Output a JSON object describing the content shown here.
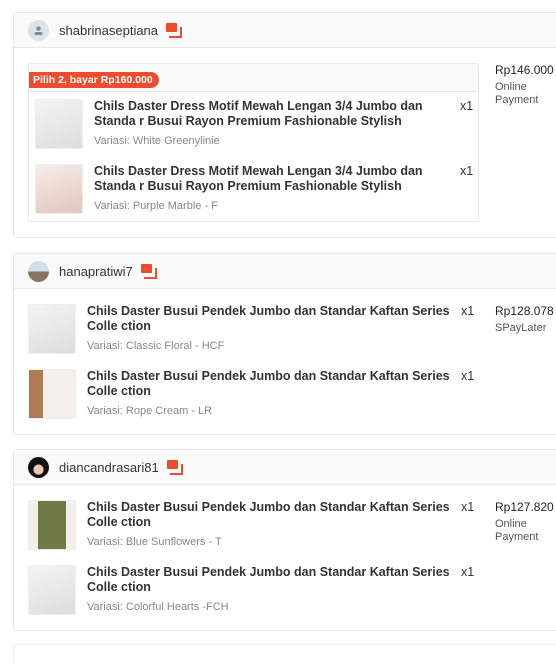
{
  "orders": [
    {
      "username": "shabrinaseptiana",
      "promo": "Pilih 2, bayar Rp160.000",
      "price": "Rp146.000",
      "payment": "Online Payment",
      "items": [
        {
          "title": "Chils Daster Dress Motif Mewah Lengan 3/4 Jumbo dan Standa r Busui Rayon Premium Fashionable Stylish",
          "qty": "x1",
          "variation": "Variasi: White Greenylinie"
        },
        {
          "title": "Chils Daster Dress Motif Mewah Lengan 3/4 Jumbo dan Standa r Busui Rayon Premium Fashionable Stylish",
          "qty": "x1",
          "variation": "Variasi: Purple Marble - F"
        }
      ]
    },
    {
      "username": "hanapratiwi7",
      "price": "Rp128.078",
      "payment": "SPayLater",
      "items": [
        {
          "title": "Chils Daster Busui Pendek Jumbo dan Standar Kaftan Series Colle ction",
          "qty": "x1",
          "variation": "Variasi: Classic Floral - HCF"
        },
        {
          "title": "Chils Daster Busui Pendek Jumbo dan Standar Kaftan Series Colle ction",
          "qty": "x1",
          "variation": "Variasi: Rope Cream - LR"
        }
      ]
    },
    {
      "username": "diancandrasari81",
      "price": "Rp127.820",
      "payment": "Online Payment",
      "items": [
        {
          "title": "Chils Daster Busui Pendek Jumbo dan Standar Kaftan Series Colle ction",
          "qty": "x1",
          "variation": "Variasi: Blue Sunflowers - T"
        },
        {
          "title": "Chils Daster Busui Pendek Jumbo dan Standar Kaftan Series Colle ction",
          "qty": "x1",
          "variation": "Variasi: Colorful Hearts -FCH"
        }
      ]
    }
  ],
  "colors": {
    "accent": "#ee4d2d"
  }
}
